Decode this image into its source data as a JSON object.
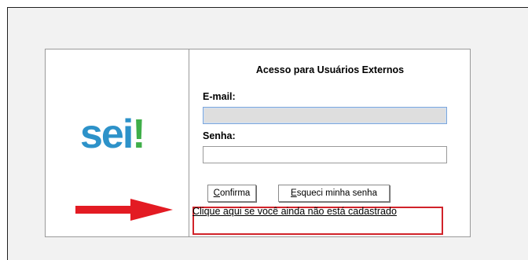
{
  "login": {
    "title": "Acesso para Usuários Externos",
    "email_label": "E-mail:",
    "email_value": "",
    "password_label": "Senha:",
    "password_value": "",
    "confirm_button": "Confirma",
    "forgot_button": "Esqueci minha senha",
    "register_link": "Clique aqui se você ainda não está cadastrado"
  },
  "logo": {
    "text_part1": "sei",
    "text_part2": "!",
    "color_blue": "#2d92c9",
    "color_green": "#3fae49"
  },
  "annotation": {
    "arrow_icon": "right-arrow-icon",
    "arrow_color": "#e31b23",
    "highlight_color": "#d1232a"
  }
}
